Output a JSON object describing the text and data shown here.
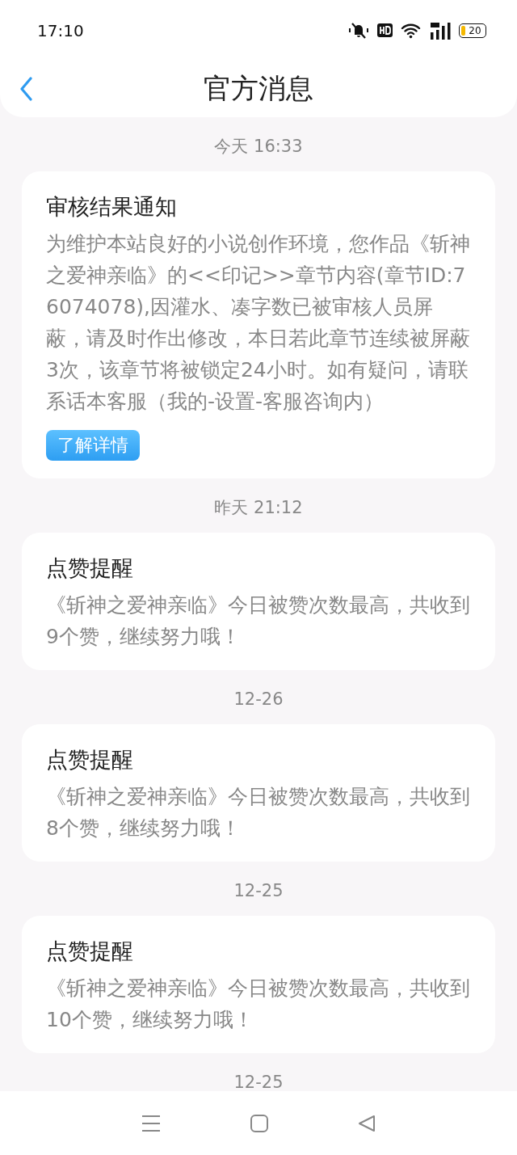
{
  "status_bar": {
    "time": "17:10",
    "battery": "20"
  },
  "header": {
    "title": "官方消息"
  },
  "feed": [
    {
      "kind": "timestamp",
      "text": "今天 16:33"
    },
    {
      "kind": "card",
      "title": "审核结果通知",
      "body": "为维护本站良好的小说创作环境，您作品《斩神之爱神亲临》的<<印记>>章节内容(章节ID:76074078),因灌水、凑字数已被审核人员屏蔽，请及时作出修改，本日若此章节连续被屏蔽3次，该章节将被锁定24小时。如有疑问，请联系话本客服（我的-设置-客服咨询内）",
      "button": "了解详情"
    },
    {
      "kind": "timestamp",
      "text": "昨天 21:12"
    },
    {
      "kind": "card",
      "title": "点赞提醒",
      "body": "《斩神之爱神亲临》今日被赞次数最高，共收到9个赞，继续努力哦！"
    },
    {
      "kind": "timestamp",
      "text": "12-26"
    },
    {
      "kind": "card",
      "title": "点赞提醒",
      "body": "《斩神之爱神亲临》今日被赞次数最高，共收到8个赞，继续努力哦！"
    },
    {
      "kind": "timestamp",
      "text": "12-25"
    },
    {
      "kind": "card",
      "title": "点赞提醒",
      "body": "《斩神之爱神亲临》今日被赞次数最高，共收到10个赞，继续努力哦！"
    },
    {
      "kind": "timestamp",
      "text": "12-25"
    }
  ]
}
